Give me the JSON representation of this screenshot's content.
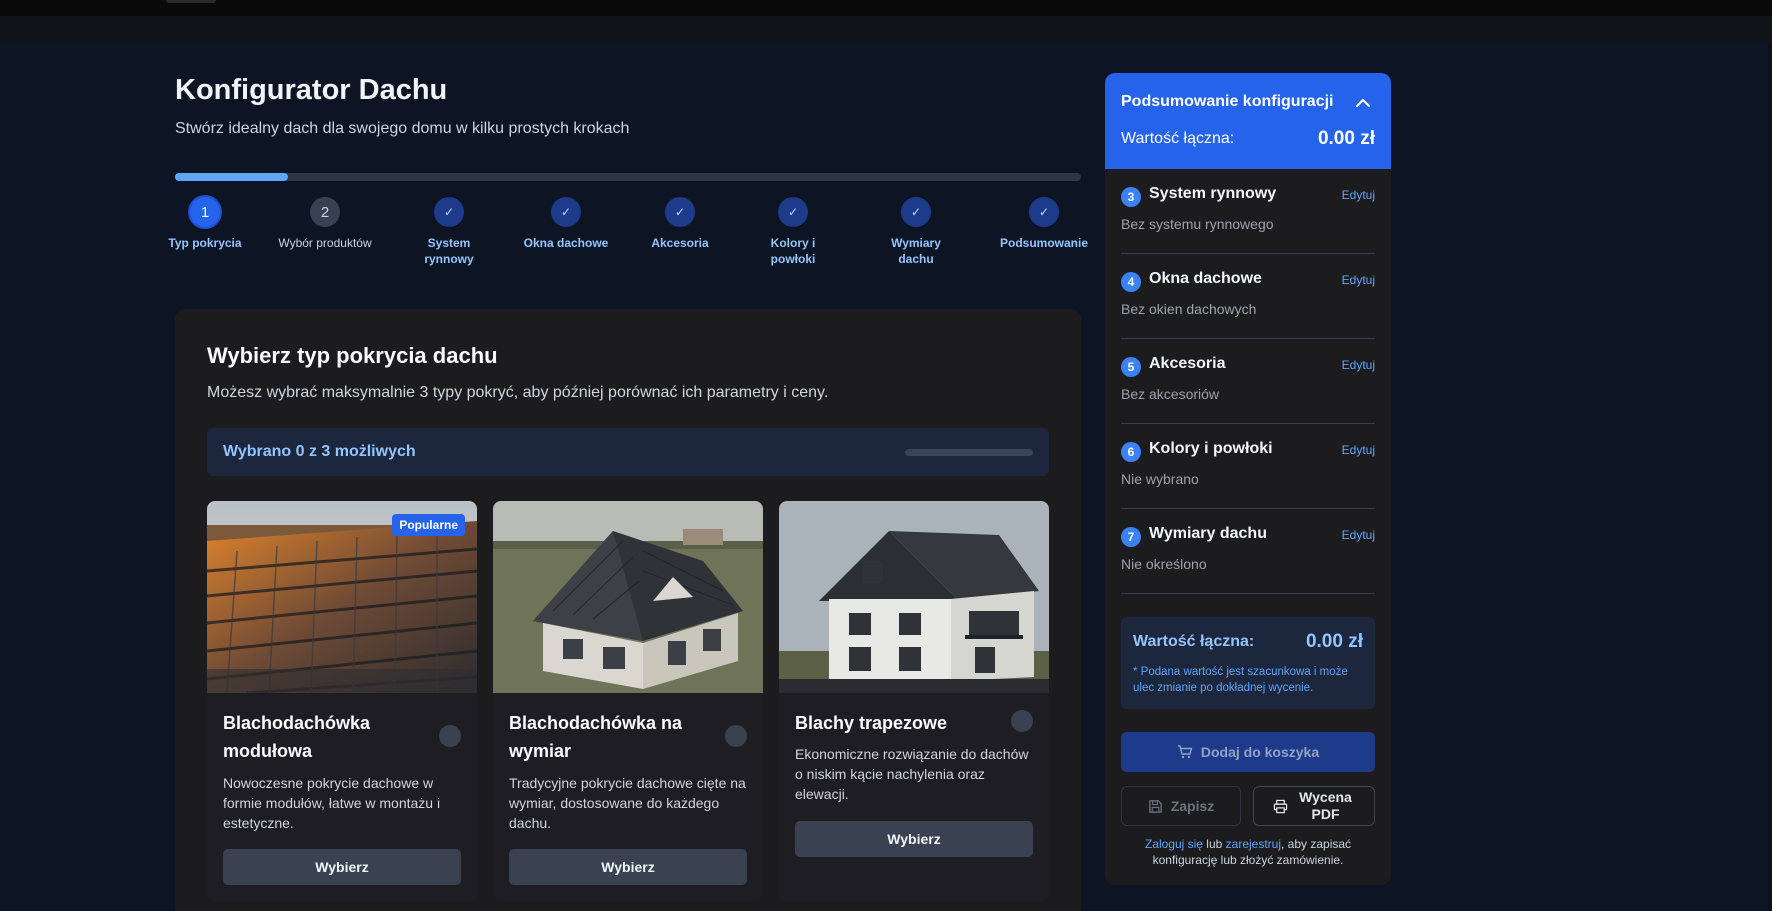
{
  "page": {
    "title": "Konfigurator Dachu",
    "subtitle": "Stwórz idealny dach dla swojego domu w kilku prostych krokach"
  },
  "progress": {
    "fraction": 0.125
  },
  "steps": [
    {
      "num": "1",
      "label": "Typ pokrycia",
      "state": "active"
    },
    {
      "num": "2",
      "label": "Wybór produktów",
      "state": "pending"
    },
    {
      "num": "✓",
      "label": "System rynnowy",
      "state": "done"
    },
    {
      "num": "✓",
      "label": "Okna dachowe",
      "state": "done"
    },
    {
      "num": "✓",
      "label": "Akcesoria",
      "state": "done"
    },
    {
      "num": "✓",
      "label": "Kolory i powłoki",
      "state": "done"
    },
    {
      "num": "✓",
      "label": "Wymiary dachu",
      "state": "done"
    },
    {
      "num": "✓",
      "label": "Podsumowanie",
      "state": "done"
    }
  ],
  "panel": {
    "title": "Wybierz typ pokrycia dachu",
    "subtitle": "Możesz wybrać maksymalnie 3 typy pokryć, aby później porównać ich parametry i ceny.",
    "counter": "Wybrano 0 z 3 możliwych"
  },
  "products": [
    {
      "title": "Blachodachówka modułowa",
      "badge": "Popularne",
      "desc": "Nowoczesne pokrycie dachowe w formie modułów, łatwe w montażu i estetyczne.",
      "button": "Wybierz"
    },
    {
      "title": "Blachodachówka na wymiar",
      "desc": "Tradycyjne pokrycie dachowe cięte na wymiar, dostosowane do każdego dachu.",
      "button": "Wybierz"
    },
    {
      "title": "Blachy trapezowe",
      "desc": "Ekonomiczne rozwiązanie do dachów o niskim kącie nachylenia oraz elewacji.",
      "button": "Wybierz"
    }
  ],
  "sidebar": {
    "title": "Podsumowanie konfiguracji",
    "total_label": "Wartość łączna:",
    "total_value": "0.00 zł",
    "items": [
      {
        "num": "3",
        "name": "System rynnowy",
        "value": "Bez systemu rynnowego",
        "edit": "Edytuj"
      },
      {
        "num": "4",
        "name": "Okna dachowe",
        "value": "Bez okien dachowych",
        "edit": "Edytuj"
      },
      {
        "num": "5",
        "name": "Akcesoria",
        "value": "Bez akcesoriów",
        "edit": "Edytuj"
      },
      {
        "num": "6",
        "name": "Kolory i powłoki",
        "value": "Nie wybrano",
        "edit": "Edytuj"
      },
      {
        "num": "7",
        "name": "Wymiary dachu",
        "value": "Nie określono",
        "edit": "Edytuj"
      }
    ],
    "summary_label": "Wartość łączna:",
    "summary_value": "0.00 zł",
    "summary_note": "* Podana wartość jest szacunkowa i może ulec zmianie po dokładnej wycenie.",
    "cart_button": "Dodaj do koszyka",
    "save_button": "Zapisz",
    "pdf_button": "Wycena PDF",
    "login_link": "Zaloguj się",
    "or_text": " lub ",
    "register_link": "zarejestruj",
    "login_rest": ", aby zapisać konfigurację lub złożyć zamówienie."
  },
  "colors": {
    "accent": "#2563eb",
    "background": "#0d1424",
    "panel": "#1c1c1f"
  }
}
